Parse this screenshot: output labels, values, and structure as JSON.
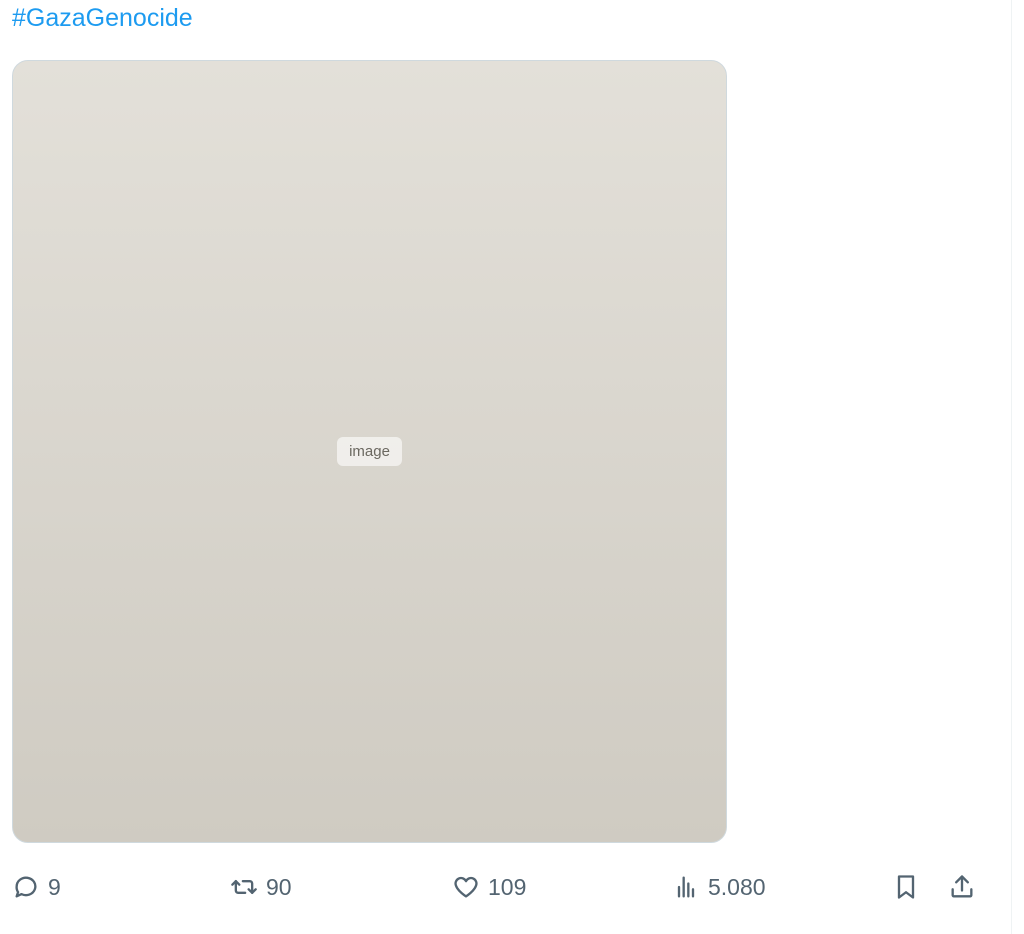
{
  "tweet": {
    "hashtag": "#GazaGenocide",
    "media": {
      "alt": ""
    }
  },
  "actions": {
    "reply_count": "9",
    "repost_count": "90",
    "like_count": "109",
    "views_count": "5.080"
  },
  "icons": {
    "reply": "reply-icon",
    "repost": "repost-icon",
    "like": "like-icon",
    "views": "views-icon",
    "bookmark": "bookmark-icon",
    "share": "share-icon"
  },
  "colors": {
    "link": "#1d9bf0",
    "icon": "#536471",
    "border": "#cfd9de"
  }
}
